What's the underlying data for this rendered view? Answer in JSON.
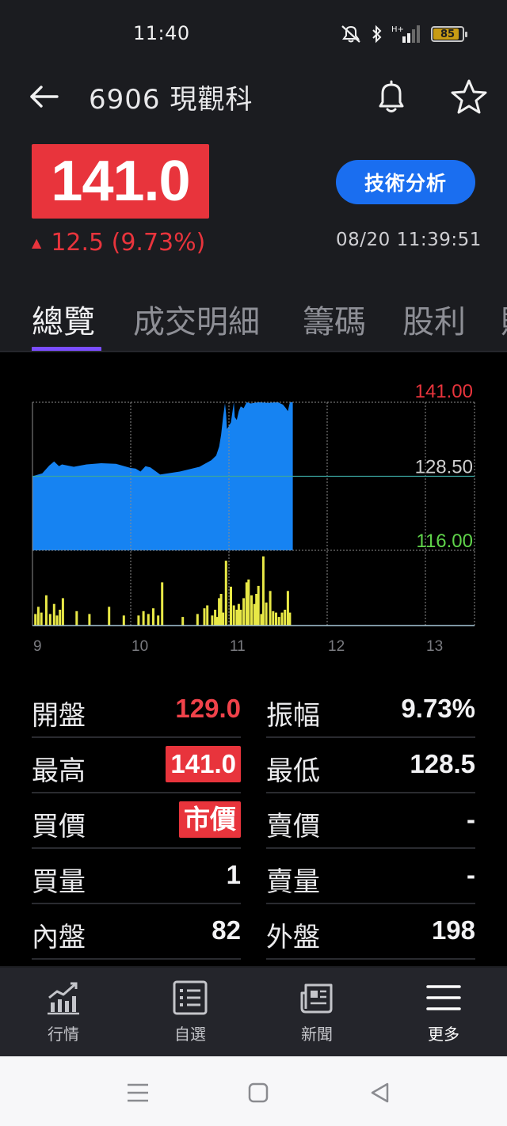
{
  "status": {
    "time": "11:40",
    "battery": "85"
  },
  "header": {
    "title": "6906 現觀科"
  },
  "quote": {
    "price": "141.0",
    "change": "12.5 (9.73%)",
    "timestamp": "08/20 11:39:51",
    "ta_button": "技術分析"
  },
  "tabs": [
    {
      "label": "總覽"
    },
    {
      "label": "成交明細"
    },
    {
      "label": "籌碼"
    },
    {
      "label": "股利"
    },
    {
      "label": "財"
    }
  ],
  "colors": {
    "up": "#e8343c",
    "down": "#39d04b",
    "accent": "#7b4dff",
    "area": "#1683f2",
    "volume": "#e8e846"
  },
  "chart_data": {
    "type": "area",
    "title": "",
    "x_ticks": [
      "9",
      "10",
      "11",
      "12",
      "13"
    ],
    "y_labels": {
      "high": "141.00",
      "ref": "128.50",
      "low": "116.00"
    },
    "ylim": [
      116,
      141
    ],
    "session": [
      9,
      13.5
    ],
    "price": {
      "x": [
        9.0,
        9.1,
        9.17,
        9.22,
        9.27,
        9.3,
        9.42,
        9.55,
        9.7,
        9.85,
        10.0,
        10.05,
        10.1,
        10.15,
        10.2,
        10.3,
        10.5,
        10.7,
        10.82,
        10.87,
        10.9,
        10.92,
        10.94,
        10.96,
        10.97,
        10.98,
        11.0,
        11.02,
        11.05,
        11.06,
        11.08,
        11.1,
        11.12,
        11.15,
        11.18,
        11.22,
        11.3,
        11.4,
        11.5,
        11.55,
        11.58,
        11.6,
        11.62,
        11.65
      ],
      "y": [
        128.5,
        129.0,
        130.3,
        131.0,
        130.2,
        130.5,
        130.1,
        130.5,
        130.7,
        130.6,
        129.9,
        129.8,
        129.3,
        130.2,
        130.0,
        128.8,
        129.3,
        130.1,
        131.2,
        132.0,
        133.5,
        135.5,
        138.5,
        140.8,
        139.2,
        136.5,
        137.0,
        137.6,
        141.0,
        138.5,
        138.0,
        139.5,
        140.3,
        140.0,
        141.0,
        140.8,
        141.0,
        140.9,
        141.0,
        140.6,
        140.0,
        139.5,
        141.0,
        141.0
      ]
    },
    "volume": {
      "x": [
        9.03,
        9.06,
        9.09,
        9.14,
        9.18,
        9.22,
        9.25,
        9.28,
        9.31,
        9.45,
        9.58,
        9.78,
        9.93,
        10.08,
        10.13,
        10.18,
        10.23,
        10.28,
        10.32,
        10.53,
        10.68,
        10.75,
        10.78,
        10.83,
        10.86,
        10.88,
        10.9,
        10.92,
        10.94,
        10.97,
        11.02,
        11.05,
        11.08,
        11.1,
        11.12,
        11.15,
        11.18,
        11.2,
        11.23,
        11.26,
        11.28,
        11.3,
        11.33,
        11.35,
        11.38,
        11.42,
        11.45,
        11.48,
        11.51,
        11.54,
        11.57,
        11.6,
        11.62
      ],
      "v": [
        16,
        26,
        18,
        42,
        16,
        30,
        14,
        22,
        38,
        20,
        16,
        26,
        14,
        14,
        20,
        16,
        24,
        14,
        60,
        12,
        16,
        24,
        28,
        14,
        22,
        12,
        38,
        44,
        18,
        90,
        54,
        28,
        22,
        30,
        22,
        38,
        60,
        64,
        42,
        30,
        44,
        55,
        16,
        96,
        32,
        48,
        20,
        18,
        12,
        18,
        22,
        48,
        18
      ]
    }
  },
  "stats": {
    "open_label": "開盤",
    "open": "129.0",
    "amp_label": "振幅",
    "amp": "9.73%",
    "high_label": "最高",
    "high": "141.0",
    "low_label": "最低",
    "low": "128.5",
    "bid_label": "買價",
    "bid": "市價",
    "ask_label": "賣價",
    "ask": "-",
    "bidvol_label": "買量",
    "bidvol": "1",
    "askvol_label": "賣量",
    "askvol": "-",
    "inner_label": "內盤",
    "inner": "82",
    "outer_label": "外盤",
    "outer": "198"
  },
  "nav": [
    {
      "label": "行情",
      "icon": "market-chart-icon"
    },
    {
      "label": "自選",
      "icon": "watchlist-icon"
    },
    {
      "label": "新聞",
      "icon": "news-icon"
    },
    {
      "label": "更多",
      "icon": "menu-icon"
    }
  ]
}
